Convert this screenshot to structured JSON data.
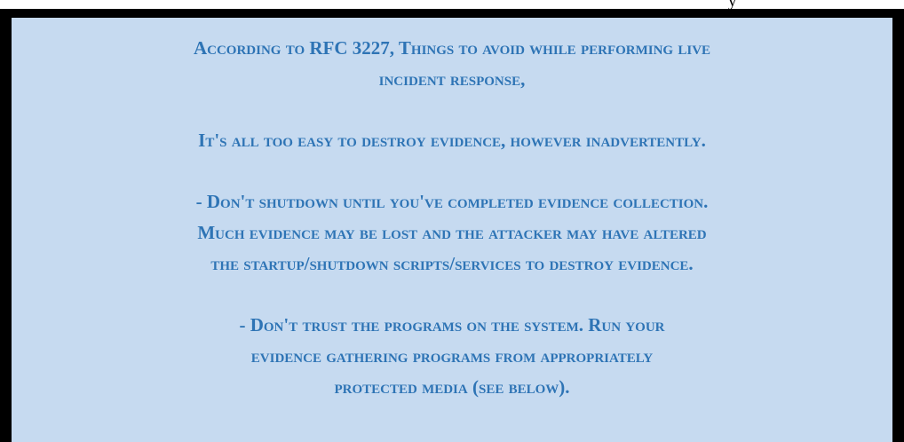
{
  "top_fragment": "y",
  "paragraphs": [
    {
      "lines": [
        "According to RFC 3227, Things to avoid while performing live",
        "incident response,"
      ]
    },
    {
      "lines": [
        "It's all too easy to destroy evidence, however inadvertently."
      ]
    },
    {
      "lines": [
        "- Don't shutdown until you've completed evidence collection.",
        "Much evidence may be lost and the attacker may have altered",
        "the startup/shutdown scripts/services to destroy evidence."
      ]
    },
    {
      "lines": [
        "- Don't trust the programs on the system. Run your",
        "evidence gathering programs from appropriately",
        "protected media (see below)."
      ]
    }
  ]
}
